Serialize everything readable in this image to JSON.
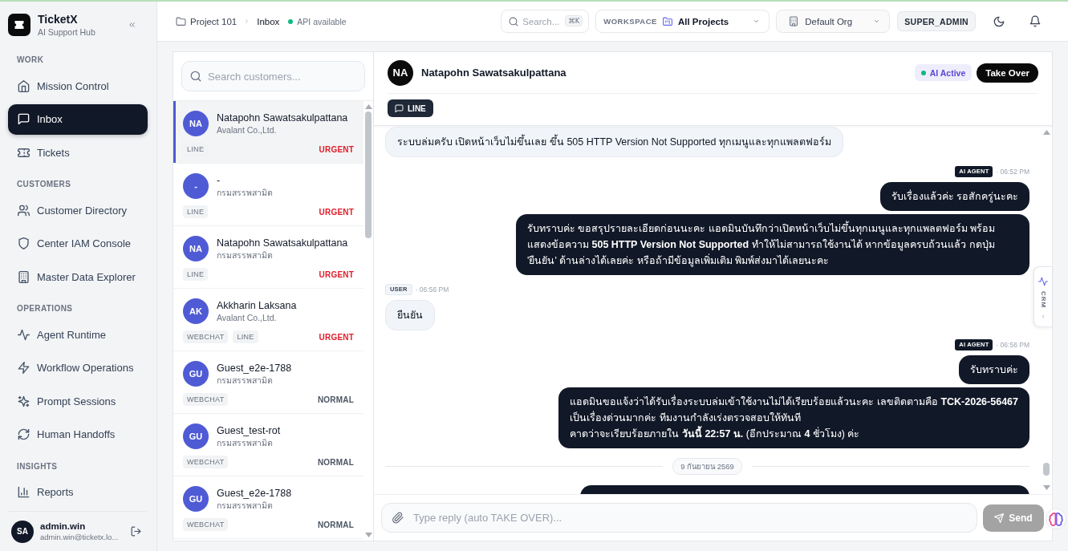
{
  "app": {
    "name": "TicketX",
    "tagline": "AI Support Hub"
  },
  "sidebar": {
    "sections": [
      {
        "title": "WORK",
        "items": [
          {
            "label": "Mission Control",
            "selected": false
          },
          {
            "label": "Inbox",
            "selected": true
          },
          {
            "label": "Tickets",
            "selected": false
          }
        ]
      },
      {
        "title": "CUSTOMERS",
        "items": [
          {
            "label": "Customer Directory",
            "selected": false
          },
          {
            "label": "Center IAM Console",
            "selected": false
          },
          {
            "label": "Master Data Explorer",
            "selected": false
          }
        ]
      },
      {
        "title": "OPERATIONS",
        "items": [
          {
            "label": "Agent Runtime",
            "selected": false
          },
          {
            "label": "Workflow Operations",
            "selected": false
          },
          {
            "label": "Prompt Sessions",
            "selected": false
          },
          {
            "label": "Human Handoffs",
            "selected": false
          }
        ]
      },
      {
        "title": "INSIGHTS",
        "items": [
          {
            "label": "Reports",
            "selected": false
          }
        ]
      }
    ],
    "user": {
      "initials": "SA",
      "name": "admin.win",
      "email": "admin.win@ticketx.lo..."
    }
  },
  "topbar": {
    "breadcrumb": [
      {
        "label": "Project 101"
      },
      {
        "label": "Inbox"
      }
    ],
    "api_status": {
      "label": "API available",
      "on": true
    },
    "search": {
      "placeholder": "Search...",
      "shortcut": "⌘K"
    },
    "workspace": {
      "label": "WORKSPACE",
      "value": "All Projects"
    },
    "org": {
      "value": "Default Org"
    },
    "role": "SUPER_ADMIN"
  },
  "customers": {
    "search": {
      "placeholder": "Search customers..."
    },
    "items": [
      {
        "initials": "NA",
        "name": "Natapohn Sawatsakulpattana",
        "org": "Avalant Co.,Ltd.",
        "channels": [
          "LINE"
        ],
        "priority": {
          "label": "URGENT",
          "color": "#e11d2a"
        },
        "selected": true
      },
      {
        "initials": "-",
        "name": "-",
        "org": "กรมสรรพสามิต",
        "channels": [
          "LINE"
        ],
        "priority": {
          "label": "URGENT",
          "color": "#e11d2a"
        },
        "selected": false
      },
      {
        "initials": "NA",
        "name": "Natapohn Sawatsakulpattana",
        "org": "กรมสรรพสามิต",
        "channels": [
          "LINE"
        ],
        "priority": {
          "label": "URGENT",
          "color": "#e11d2a"
        },
        "selected": false
      },
      {
        "initials": "AK",
        "name": "Akkharin Laksana",
        "org": "Avalant Co.,Ltd.",
        "channels": [
          "WEBCHAT",
          "LINE"
        ],
        "priority": {
          "label": "URGENT",
          "color": "#e11d2a"
        },
        "selected": false
      },
      {
        "initials": "GU",
        "name": "Guest_e2e-1788",
        "org": "กรมสรรพสามิต",
        "channels": [
          "WEBCHAT"
        ],
        "priority": {
          "label": "NORMAL",
          "color": "#4b5563"
        },
        "selected": false
      },
      {
        "initials": "GU",
        "name": "Guest_test-rot",
        "org": "กรมสรรพสามิต",
        "channels": [
          "WEBCHAT"
        ],
        "priority": {
          "label": "NORMAL",
          "color": "#4b5563"
        },
        "selected": false
      },
      {
        "initials": "GU",
        "name": "Guest_e2e-1788",
        "org": "กรมสรรพสามิต",
        "channels": [
          "WEBCHAT"
        ],
        "priority": {
          "label": "NORMAL",
          "color": "#4b5563"
        },
        "selected": false
      }
    ]
  },
  "chat": {
    "contact": {
      "initials": "NA",
      "name": "Natapohn Sawatsakulpattana"
    },
    "ai_status": {
      "label": "AI Active",
      "on": true
    },
    "take_over": "Take Over",
    "channel": "LINE",
    "crm_tab": "CRM",
    "messages": [
      {
        "kind": "user",
        "text": "ระบบล่มครับ เปิดหน้าเว็บไม่ขึ้นเลย ขึ้น 505 HTTP Version Not Supported ทุกเมนูและทุกแพลตฟอร์ม"
      },
      {
        "kind": "agent_meta",
        "sender": "AI AGENT",
        "time": "· 06:52 PM"
      },
      {
        "kind": "agent",
        "text": "รับเรื่องแล้วค่ะ รอสักครู่นะคะ"
      },
      {
        "kind": "agent",
        "text": "รับทราบค่ะ ขอสรุปรายละเอียดก่อนนะคะ แอดมินบันทึกว่าเปิดหน้าเว็บไม่ขึ้นทุกเมนูและทุกแพลตฟอร์ม พร้อมแสดงข้อความ **505 HTTP Version Not Supported** ทำให้ไม่สามารถใช้งานได้ หากข้อมูลครบถ้วนแล้ว กดปุ่ม 'ยืนยัน' ด้านล่างได้เลยค่ะ หรือถ้ามีข้อมูลเพิ่มเติม พิมพ์ส่งมาได้เลยนะคะ"
      },
      {
        "kind": "user_meta",
        "sender": "USER",
        "time": "· 06:56 PM"
      },
      {
        "kind": "user",
        "text": "ยืนยัน"
      },
      {
        "kind": "agent_meta",
        "sender": "AI AGENT",
        "time": "· 06:56 PM"
      },
      {
        "kind": "agent",
        "text": "รับทราบค่ะ"
      },
      {
        "kind": "agent",
        "text": "แอดมินขอแจ้งว่าได้รับเรื่องระบบล่มเข้าใช้งานไม่ได้เรียบร้อยแล้วนะคะ เลขติดตามคือ **TCK-2026-56467**\nเป็นเรื่องด่วนมากค่ะ ทีมงานกำลังเร่งตรวจสอบให้ทันที\nคาดว่าจะเรียบร้อยภายใน **วันนี้ 22:57 น.** (อีกประมาณ **4** ชั่วโมง) ค่ะ"
      },
      {
        "kind": "date",
        "text": "9 กันยายน 2569"
      },
      {
        "kind": "agent_cut"
      }
    ]
  },
  "composer": {
    "placeholder": "Type reply (auto TAKE OVER)...",
    "send": "Send",
    "send_disabled": true
  }
}
